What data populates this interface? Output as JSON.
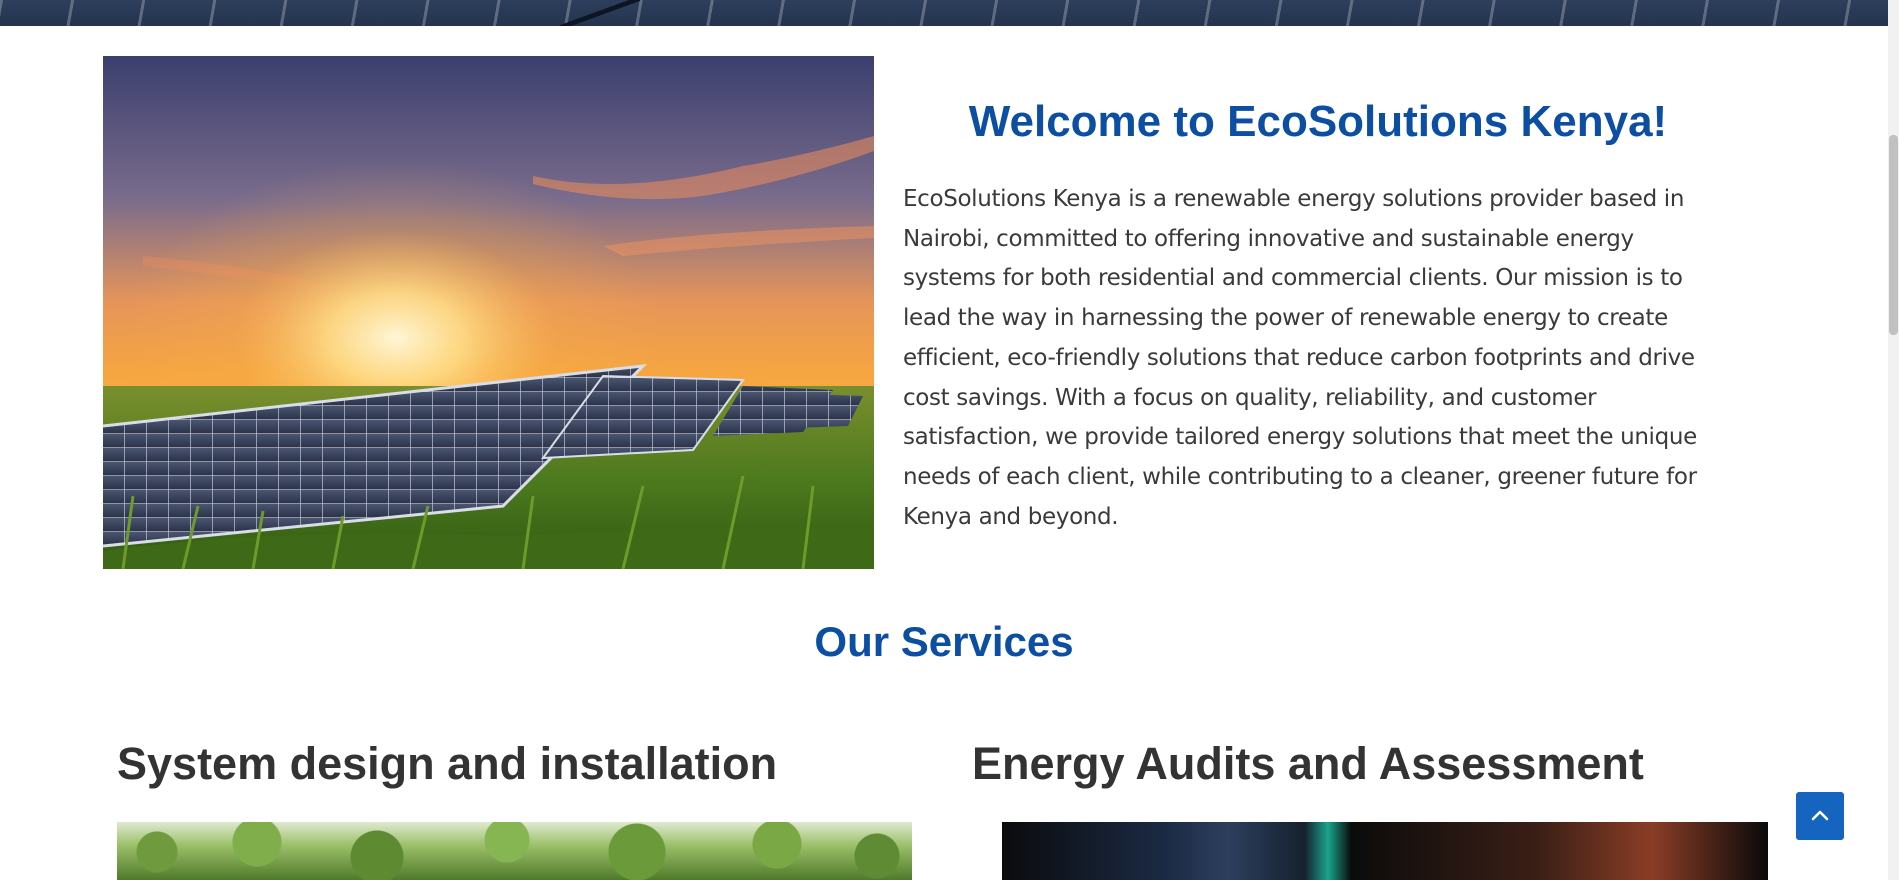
{
  "welcome": {
    "title": "Welcome to EcoSolutions Kenya!",
    "body": "EcoSolutions Kenya is a renewable energy solutions provider based in Nairobi, committed to offering innovative and sustainable energy systems for both residential and commercial clients. Our mission is to lead the way in harnessing the power of renewable energy to create efficient, eco-friendly solutions that reduce carbon footprints and drive cost savings. With a focus on quality, reliability, and customer satisfaction, we provide tailored energy solutions that meet the unique needs of each client, while contributing to a cleaner, greener future for Kenya and beyond."
  },
  "services": {
    "title": "Our Services",
    "items": [
      {
        "title": "System design and installation"
      },
      {
        "title": "Energy Audits and Assessment"
      }
    ]
  },
  "icons": {
    "back_to_top": "chevron-up-icon"
  },
  "colors": {
    "accent_heading": "#0b4ea2",
    "dark_heading": "#333333",
    "body_text": "#3a3a3a",
    "back_to_top_bg": "#1565c0"
  }
}
